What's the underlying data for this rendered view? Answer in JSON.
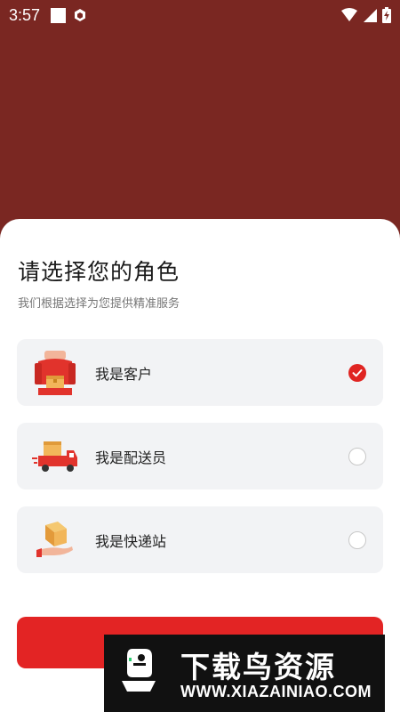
{
  "status_bar": {
    "time": "3:57",
    "icons": [
      "notification-square-icon",
      "app-badge-icon",
      "wifi-icon",
      "signal-icon",
      "battery-charging-icon"
    ]
  },
  "sheet": {
    "title": "请选择您的角色",
    "subtitle": "我们根据选择为您提供精准服务"
  },
  "roles": [
    {
      "label": "我是客户",
      "icon": "customer-illustration-icon",
      "selected": true
    },
    {
      "label": "我是配送员",
      "icon": "delivery-truck-illustration-icon",
      "selected": false
    },
    {
      "label": "我是快递站",
      "icon": "parcel-hand-illustration-icon",
      "selected": false
    }
  ],
  "watermark": {
    "title": "下载鸟资源",
    "url": "WWW.XIAZAINIAO.COM"
  },
  "colors": {
    "header_bg": "#7a2722",
    "accent": "#e32424",
    "card_bg": "#f2f3f5"
  }
}
